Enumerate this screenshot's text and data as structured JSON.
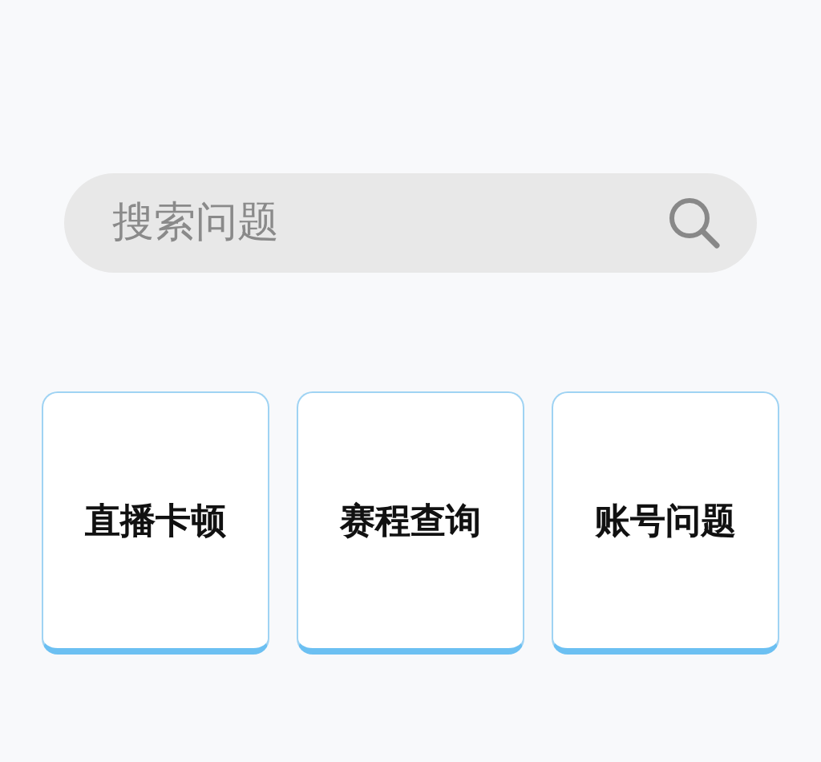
{
  "search": {
    "placeholder": "搜索问题"
  },
  "topics": [
    {
      "label": "直播卡顿"
    },
    {
      "label": "赛程查询"
    },
    {
      "label": "账号问题"
    }
  ]
}
